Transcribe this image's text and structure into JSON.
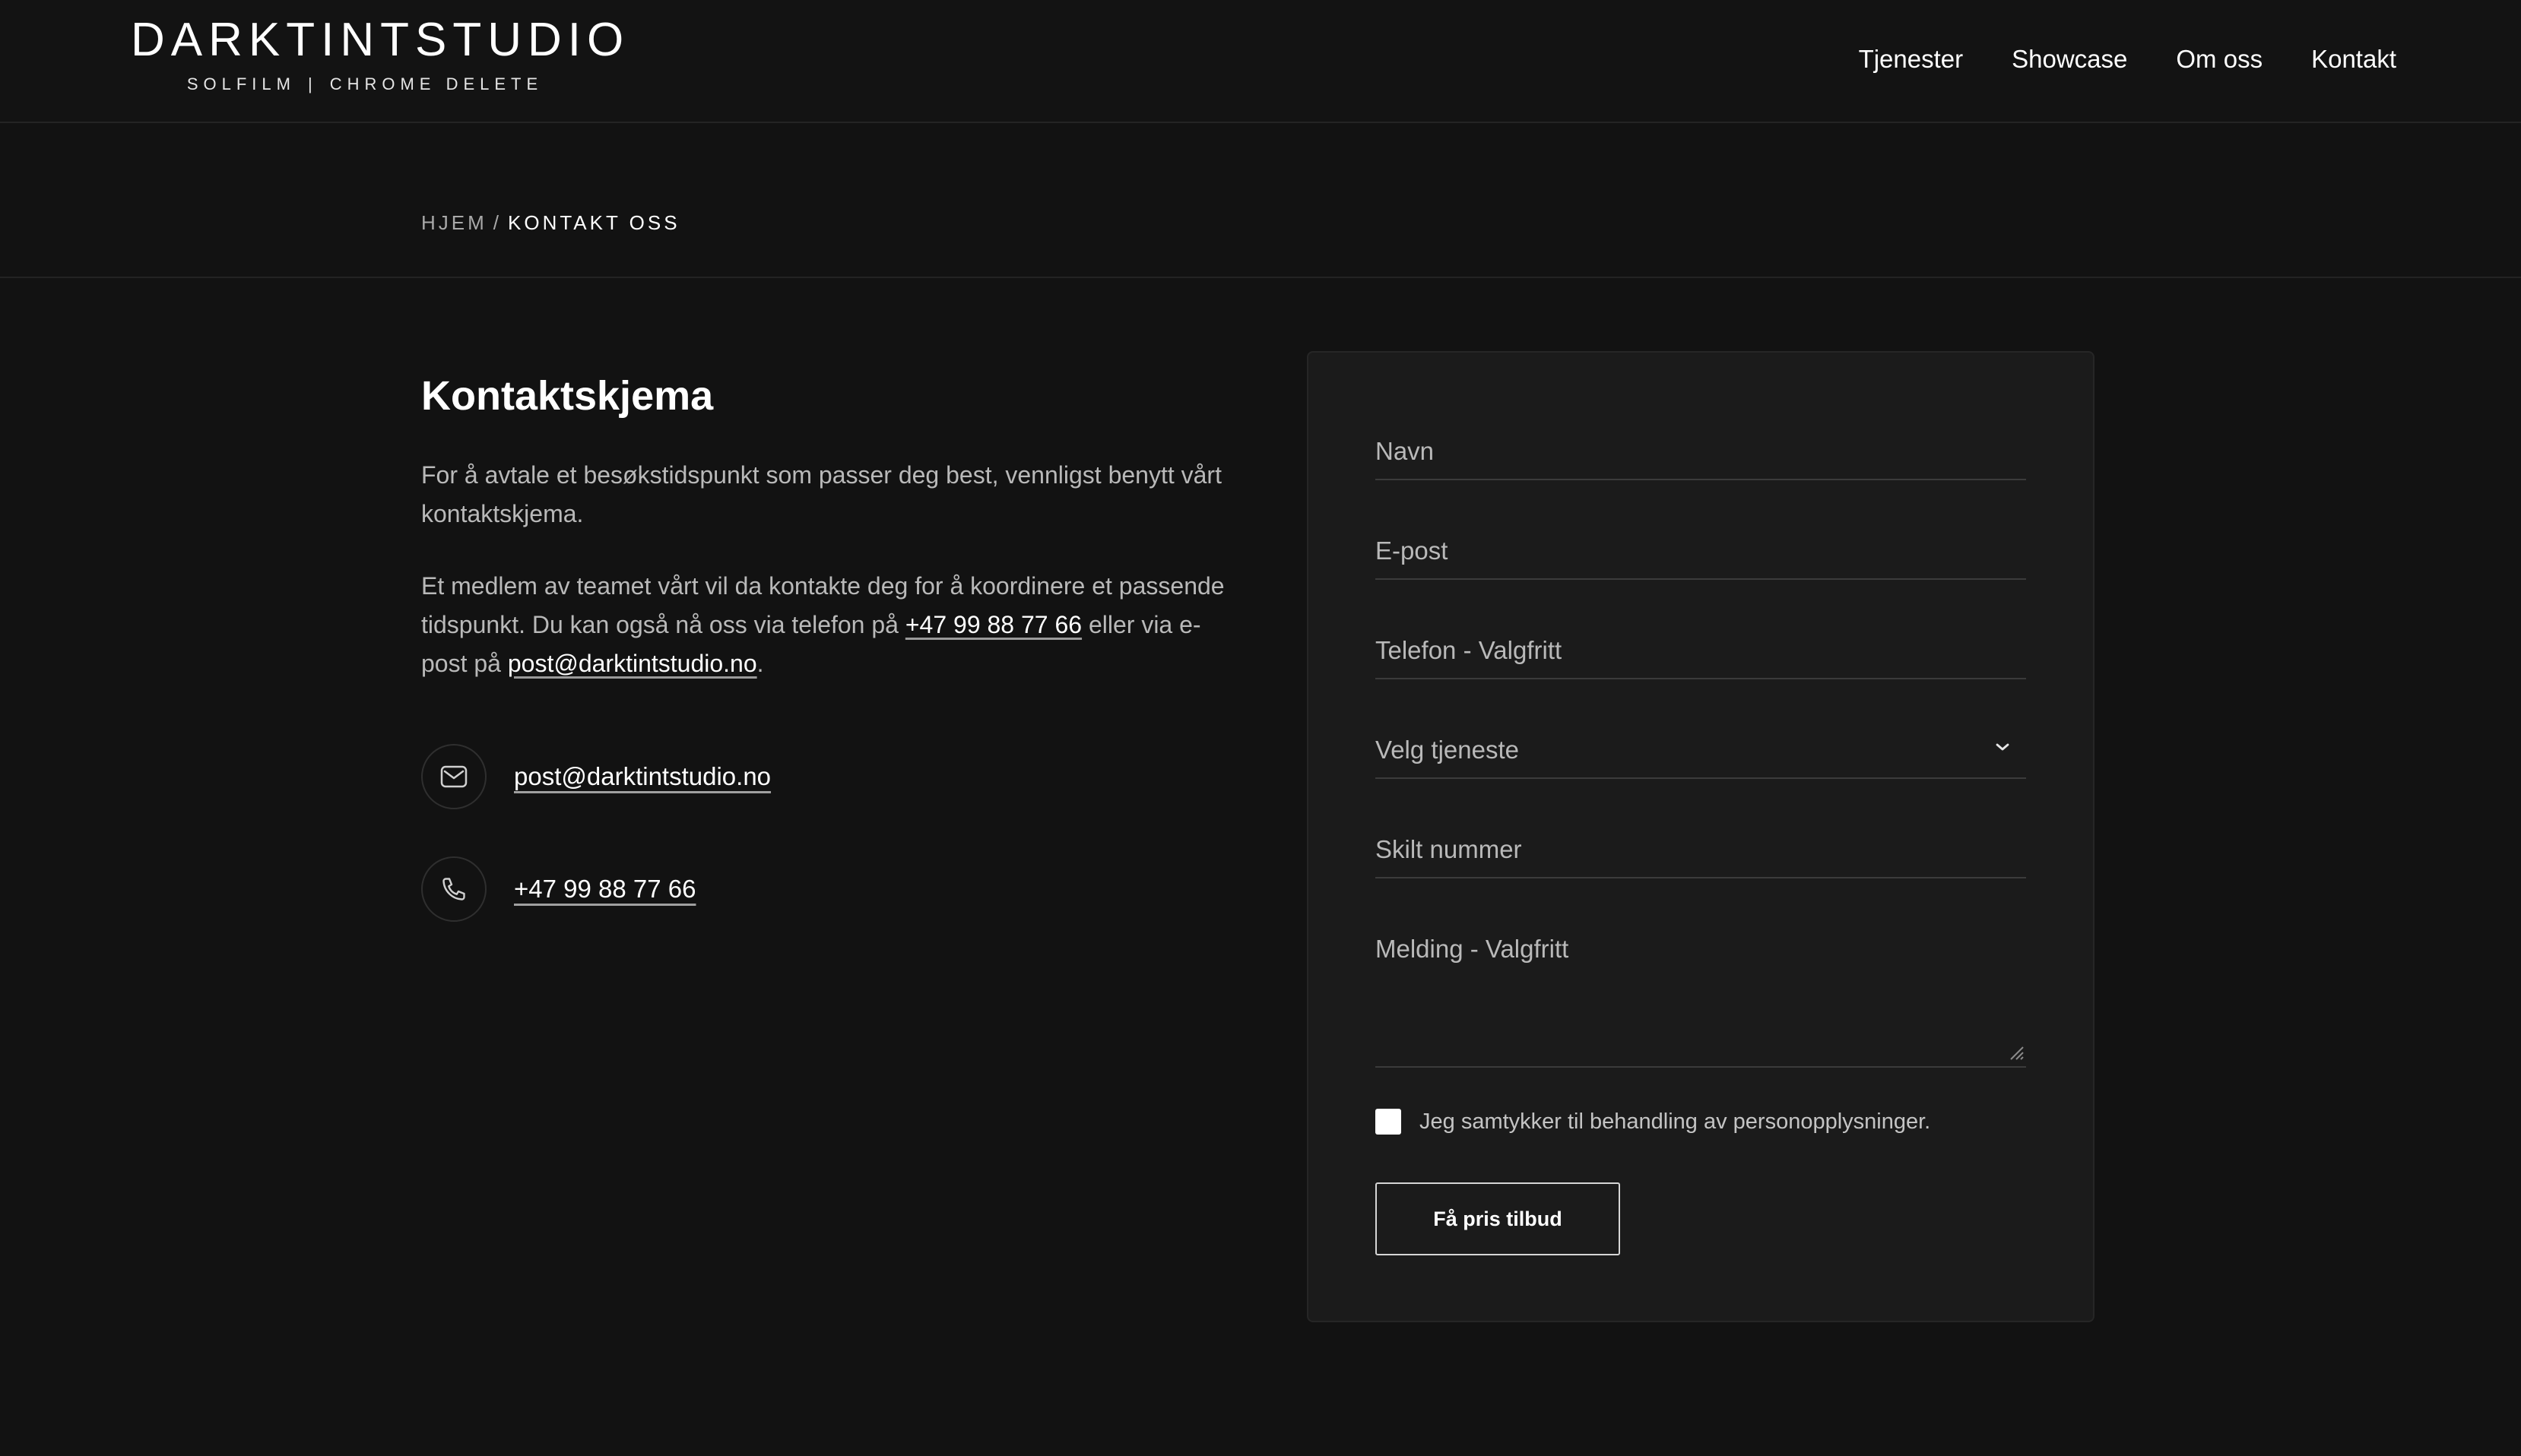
{
  "brand": {
    "name": "DARKTINTSTUDIO",
    "tagline_left": "SOLFILM",
    "tagline_sep": "|",
    "tagline_right": "CHROME DELETE"
  },
  "nav": {
    "items": [
      {
        "label": "Tjenester"
      },
      {
        "label": "Showcase"
      },
      {
        "label": "Om oss"
      },
      {
        "label": "Kontakt"
      }
    ]
  },
  "breadcrumb": {
    "home": "HJEM",
    "separator": "/",
    "current": "KONTAKT OSS"
  },
  "intro": {
    "title": "Kontaktskjema",
    "paragraph1": "For å avtale et besøkstidspunkt som passer deg best, vennligst benytt vårt kontaktskjema.",
    "paragraph2_before": "Et medlem av teamet vårt vil da kontakte deg for å koordinere et passende tidspunkt. Du kan også nå oss via telefon på ",
    "paragraph2_phone": "+47 99 88 77 66",
    "paragraph2_middle": " eller via e-post på ",
    "paragraph2_email": "post@darktintstudio.no",
    "paragraph2_after": "."
  },
  "contact": {
    "email": {
      "icon": "mail-icon",
      "value": "post@darktintstudio.no"
    },
    "phone": {
      "icon": "phone-icon",
      "value": "+47 99 88 77 66"
    }
  },
  "form": {
    "name_placeholder": "Navn",
    "email_placeholder": "E-post",
    "phone_placeholder": "Telefon - Valgfritt",
    "service_placeholder": "Velg tjeneste",
    "plate_placeholder": "Skilt nummer",
    "message_placeholder": "Melding - Valgfritt",
    "consent_label": "Jeg samtykker til behandling av personopplysninger.",
    "consent_checked": false,
    "submit_label": "Få pris tilbud"
  },
  "colors": {
    "background": "#121212",
    "card": "#1b1b1b",
    "text": "#ffffff",
    "muted_text": "#b9b9b9",
    "divider": "#3b3b3b"
  }
}
